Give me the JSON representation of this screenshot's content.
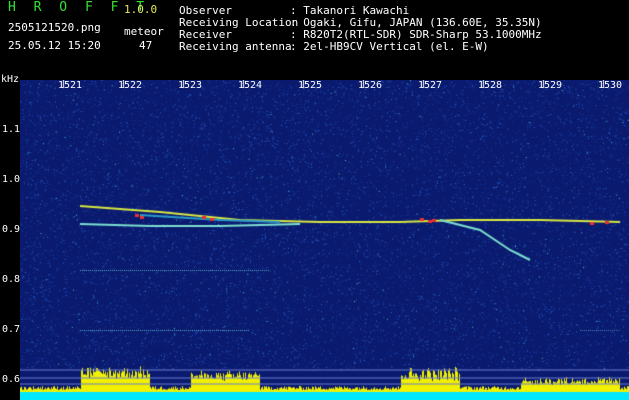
{
  "header": {
    "brand": "H R O F F T",
    "version": "1.0.0",
    "filename": "2505121520.png",
    "datetime": "25.05.12 15:20",
    "meteor_label": "meteor",
    "meteor_count": "47",
    "fields": [
      {
        "label": "Observer",
        "value": ": Takanori Kawachi"
      },
      {
        "label": "Receiving Location",
        "value": ": Ogaki, Gifu, JAPAN (136.60E, 35.35N)"
      },
      {
        "label": "Receiver",
        "value": ": R820T2(RTL-SDR) SDR-Sharp 53.1000MHz"
      },
      {
        "label": "Receiving antenna",
        "value": ": 2el-HB9CV Vertical (el. E-W)"
      }
    ]
  },
  "spectrogram": {
    "y_unit": "kHz",
    "y_ticks": [
      "1.1",
      "1.0",
      "0.9",
      "0.8",
      "0.7",
      "0.6"
    ],
    "x_ticks": [
      "1521",
      "1522",
      "1523",
      "1524",
      "1525",
      "1526",
      "1527",
      "1528",
      "1529",
      "1530"
    ],
    "colors": {
      "background": "#0a1a6e",
      "noise": "#2a6bd8",
      "signal": "#d8e840",
      "peak": "#e83030",
      "baseline": "#00e8ff",
      "histogram": "#f0f000"
    }
  }
}
